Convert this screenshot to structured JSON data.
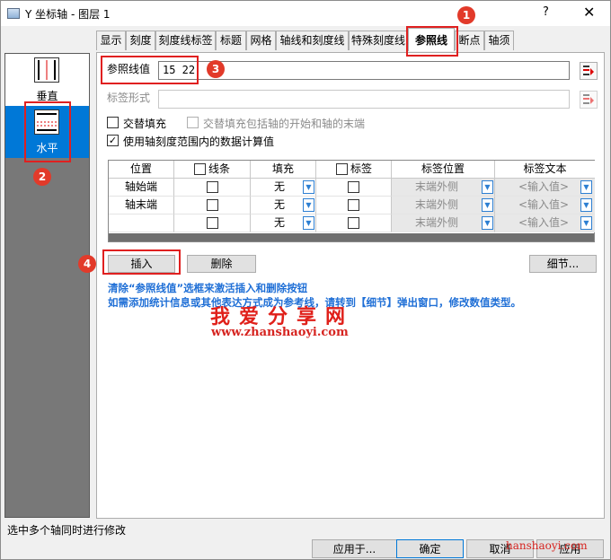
{
  "window": {
    "title": "Y 坐标轴 - 图层 1",
    "help_glyph": "?",
    "close_glyph": "✕"
  },
  "tabs": [
    {
      "label": "显示"
    },
    {
      "label": "刻度"
    },
    {
      "label": "刻度线标签"
    },
    {
      "label": "标题"
    },
    {
      "label": "网格"
    },
    {
      "label": "轴线和刻度线"
    },
    {
      "label": "特殊刻度线"
    },
    {
      "label": "参照线",
      "active": true
    },
    {
      "label": "断点"
    },
    {
      "label": "轴须"
    }
  ],
  "sidebar": {
    "items": [
      {
        "label": "垂直",
        "icon": "vertical-axis-icon",
        "selected": false
      },
      {
        "label": "水平",
        "icon": "horizontal-axis-icon",
        "selected": true
      }
    ]
  },
  "form": {
    "ref_value_label": "参照线值",
    "ref_value": "15 22",
    "label_format_label": "标签形式",
    "label_format_value": "",
    "alt_fill_label": "交替填充",
    "alt_fill_checked": false,
    "alt_fill_ends_label": "交替填充包括轴的开始和轴的末端",
    "alt_fill_ends_checked": false,
    "use_scale_label": "使用轴刻度范围内的数据计算值",
    "use_scale_checked": true
  },
  "grid": {
    "headers": [
      "位置",
      "线条",
      "填充",
      "标签",
      "标签位置",
      "标签文本"
    ],
    "rows": [
      {
        "position": "轴始端",
        "line": false,
        "fill": "无",
        "label": false,
        "label_pos": "末端外侧",
        "label_text": "<输入值>"
      },
      {
        "position": "轴末端",
        "line": false,
        "fill": "无",
        "label": false,
        "label_pos": "末端外侧",
        "label_text": "<输入值>"
      },
      {
        "position": "",
        "line": false,
        "fill": "无",
        "label": false,
        "label_pos": "末端外侧",
        "label_text": "<输入值>"
      }
    ]
  },
  "buttons": {
    "insert": "插入",
    "delete": "删除",
    "details": "细节...",
    "apply": "应用于...",
    "ok": "确定",
    "cancel": "取消",
    "apply2": "应用"
  },
  "hints": {
    "line1": "清除“参照线值”选框来激活插入和删除按钮",
    "line2": "如需添加统计信息或其他表达方式成为参考线，请转到【细节】弹出窗口，修改数值类型。"
  },
  "watermark": {
    "title": "我爱分享网",
    "url": "www.zhanshaoyi.com",
    "corner": "hanshaoyi.com"
  },
  "status": {
    "text": "选中多个轴同时进行修改"
  },
  "annotations": {
    "badges": [
      "1",
      "2",
      "3",
      "4"
    ]
  },
  "colors": {
    "accent": "#0078d7",
    "annotation": "#e02020",
    "hint_text": "#1f6fd6",
    "watermark": "#d62420"
  }
}
